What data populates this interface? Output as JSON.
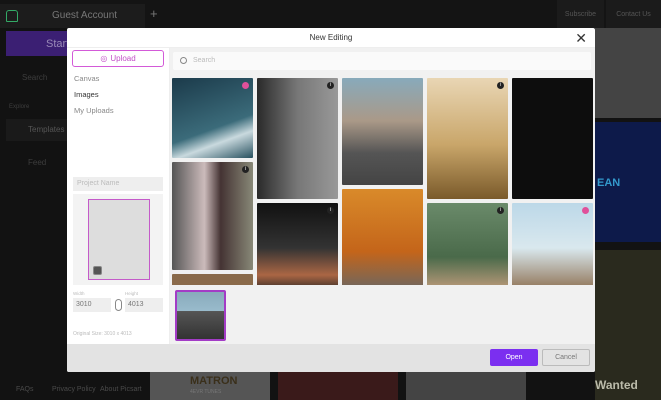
{
  "app": {
    "tab_label": "Guest Account",
    "start_label": "Start",
    "subscribe_label": "Subscribe",
    "contact_label": "Contact Us",
    "search_label": "Search",
    "explore_label": "Explore",
    "templates_label": "Templates",
    "feed_label": "Feed",
    "footer": [
      "FAQs",
      "Privacy Policy",
      "About Picsart"
    ],
    "bg_cards": {
      "matron": "MATRON",
      "matron_sub": "4EVR TUNES",
      "wanted": "Wanted",
      "ean": "EAN"
    }
  },
  "modal": {
    "title": "New Editing",
    "upload_label": "Upload",
    "nav": [
      "Canvas",
      "Images",
      "My Uploads"
    ],
    "active_nav": "Images",
    "project_name_placeholder": "Project Name",
    "width_label": "Width",
    "height_label": "Height",
    "width": "3010",
    "height": "4013",
    "original_size": "Original Size: 3010 x 4013",
    "search_placeholder": "Search",
    "open_label": "Open",
    "cancel_label": "Cancel",
    "accent": "#7b2ff0"
  }
}
